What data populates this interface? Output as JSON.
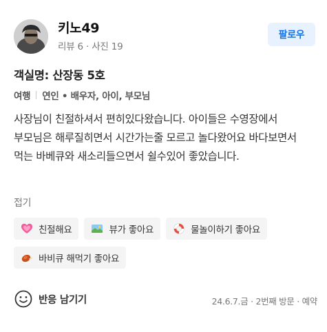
{
  "user": {
    "name": "키노49",
    "stats": "리뷰 6 · 사진 19"
  },
  "follow_label": "팔로우",
  "room": {
    "title": "객실명: 산장동 5호"
  },
  "trip": {
    "type": "여행",
    "companions": "연인 • 배우자, 아이, 부모님"
  },
  "review": {
    "text": "사장님이 친절하셔서 편히있다왔습니다. 아이들은 수영장에서 부모님은 해루질히면서 시간가는줄 모르고 놀다왔어요 바다보면서 먹는 바베큐와 새소리들으면서 쉴수있어 좋았습니다.",
    "collapse_label": "접기"
  },
  "keywords": [
    {
      "icon": "heart-icon",
      "label": "친절해요"
    },
    {
      "icon": "landscape-icon",
      "label": "뷰가 좋아요"
    },
    {
      "icon": "lifebuoy-icon",
      "label": "물놀이하기 좋아요"
    },
    {
      "icon": "bbq-icon",
      "label": "바비큐 해먹기 좋아요"
    }
  ],
  "reaction": {
    "icon": "smile-icon",
    "label": "반응 남기기"
  },
  "visit_info": "24.6.7.금 · 2번째 방문 · 예약",
  "colors": {
    "accent": "#1273e4",
    "accent_bg": "#e8f2ff",
    "chip_bg": "#f4f4f4"
  }
}
